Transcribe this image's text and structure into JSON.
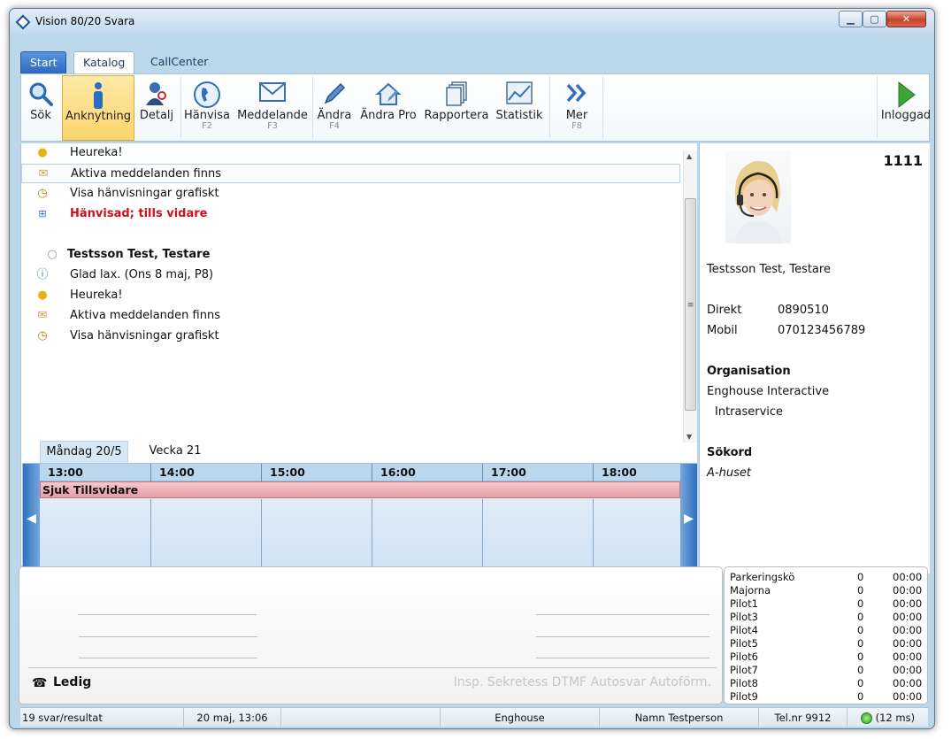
{
  "window": {
    "title": "Vision 80/20 Svara",
    "min": "▁",
    "max": "▢",
    "close": "✕"
  },
  "tabs": [
    {
      "label": "Start"
    },
    {
      "label": "Katalog"
    },
    {
      "label": "CallCenter"
    }
  ],
  "ribbon": [
    {
      "label": "Sök",
      "key": "",
      "icon": "search-icon"
    },
    {
      "label": "Anknytning",
      "key": "",
      "icon": "person-info-icon",
      "selected": true
    },
    {
      "label": "Detalj",
      "key": "",
      "icon": "person-detail-icon"
    },
    {
      "label": "Hänvisa",
      "key": "F2",
      "icon": "phone-icon"
    },
    {
      "label": "Meddelande",
      "key": "F3",
      "icon": "envelope-icon"
    },
    {
      "label": "Ändra",
      "key": "F4",
      "icon": "pencil-icon"
    },
    {
      "label": "Ändra Pro",
      "key": "",
      "icon": "home-edit-icon"
    },
    {
      "label": "Rapportera",
      "key": "",
      "icon": "documents-icon"
    },
    {
      "label": "Statistik",
      "key": "",
      "icon": "chart-icon"
    },
    {
      "label": "Mer",
      "key": "F8",
      "icon": "double-chevron-icon"
    },
    {
      "label": "Inloggad",
      "key": "",
      "icon": "play-icon"
    }
  ],
  "list": [
    {
      "text": "Heureka!",
      "icon": "lightbulb-icon"
    },
    {
      "text": "Aktiva meddelanden finns",
      "icon": "envelope-icon"
    },
    {
      "text": "Visa hänvisningar grafiskt",
      "icon": "clock-icon"
    },
    {
      "text": "Hänvisad;  tills vidare",
      "icon": "plus-box-icon"
    },
    {
      "text": "Testsson Test, Testare",
      "icon": "status-circle-icon"
    },
    {
      "text": "Glad lax.  (Ons 8 maj, P8)",
      "icon": "info-icon"
    },
    {
      "text": "Heureka!",
      "icon": "lightbulb-icon"
    },
    {
      "text": "Aktiva meddelanden finns",
      "icon": "envelope-icon"
    },
    {
      "text": "Visa hänvisningar grafiskt",
      "icon": "clock-icon"
    }
  ],
  "calendar": {
    "tabs": [
      "Måndag 20/5",
      "Vecka 21"
    ],
    "hours": [
      "13:00",
      "14:00",
      "15:00",
      "16:00",
      "17:00",
      "18:00"
    ],
    "event": "Sjuk Tillsvidare"
  },
  "contact": {
    "extension": "1111",
    "name": "Testsson Test, Testare",
    "direkt_label": "Direkt",
    "direkt": "0890510",
    "mobil_label": "Mobil",
    "mobil": "070123456789",
    "org_label": "Organisation",
    "org": "Enghouse Interactive",
    "dept": "Intraservice",
    "sokord_label": "Sökord",
    "sokord": "A-huset"
  },
  "call": {
    "state": "Ledig",
    "options": "Insp. Sekretess DTMF Autosvar Autoförm."
  },
  "queues": [
    {
      "name": "Parkeringskö",
      "count": "0",
      "time": "00:00"
    },
    {
      "name": "Majorna",
      "count": "0",
      "time": "00:00"
    },
    {
      "name": "Pilot1",
      "count": "0",
      "time": "00:00"
    },
    {
      "name": "Pilot3",
      "count": "0",
      "time": "00:00"
    },
    {
      "name": "Pilot4",
      "count": "0",
      "time": "00:00"
    },
    {
      "name": "Pilot5",
      "count": "0",
      "time": "00:00"
    },
    {
      "name": "Pilot6",
      "count": "0",
      "time": "00:00"
    },
    {
      "name": "Pilot7",
      "count": "0",
      "time": "00:00"
    },
    {
      "name": "Pilot8",
      "count": "0",
      "time": "00:00"
    },
    {
      "name": "Pilot9",
      "count": "0",
      "time": "00:00"
    }
  ],
  "statusbar": {
    "results": "19 svar/resultat",
    "datetime": "20 maj, 13:06",
    "company": "Enghouse",
    "user": "Namn Testperson",
    "telnr": "Tel.nr 9912",
    "latency": "(12 ms)"
  }
}
